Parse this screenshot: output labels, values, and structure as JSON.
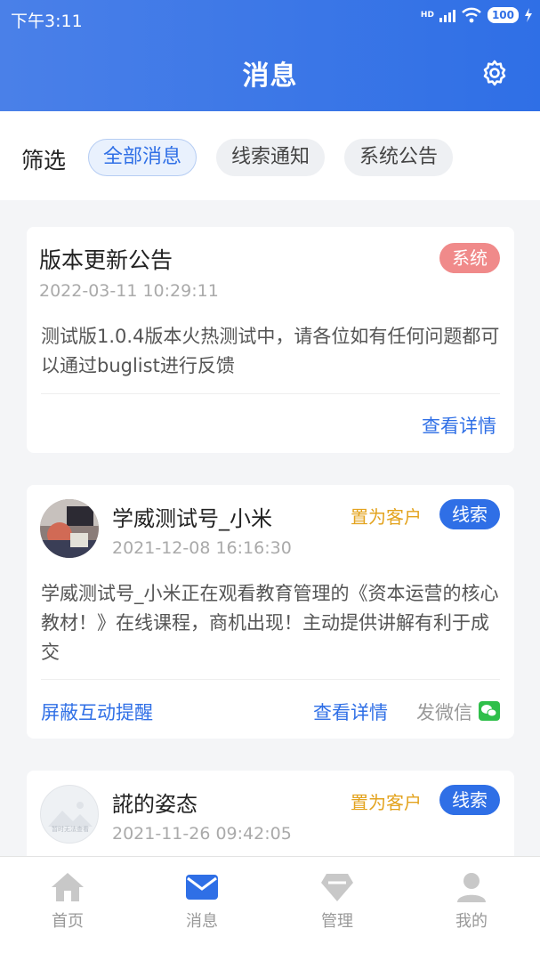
{
  "status_bar": {
    "time": "下午3:11",
    "network": "HD",
    "battery": "100"
  },
  "header": {
    "title": "消息"
  },
  "filter": {
    "label": "筛选",
    "chips": [
      {
        "label": "全部消息",
        "active": true
      },
      {
        "label": "线索通知",
        "active": false
      },
      {
        "label": "系统公告",
        "active": false
      }
    ]
  },
  "messages": [
    {
      "title": "版本更新公告",
      "tag": "系统",
      "time": "2022-03-11 10:29:11",
      "body": "测试版1.0.4版本火热测试中，请各位如有任何问题都可以通过buglist进行反馈",
      "detail_link": "查看详情"
    },
    {
      "name": "学威测试号_小米",
      "set_customer": "置为客户",
      "tag": "线索",
      "time": "2021-12-08 16:16:30",
      "body": "学威测试号_小米正在观看教育管理的《资本运营的核心教材！》在线课程，商机出现！主动提供讲解有利于成交",
      "block_link": "屏蔽互动提醒",
      "detail_link": "查看详情",
      "wechat_label": "发微信"
    },
    {
      "name": "誮的姿态",
      "set_customer": "置为客户",
      "tag": "线索",
      "time": "2021-11-26 09:42:05",
      "avatar_placeholder": "暂时无法查看"
    }
  ],
  "tabbar": [
    {
      "label": "首页",
      "icon": "home-icon",
      "active": false
    },
    {
      "label": "消息",
      "icon": "message-icon",
      "active": true
    },
    {
      "label": "管理",
      "icon": "diamond-icon",
      "active": false
    },
    {
      "label": "我的",
      "icon": "user-icon",
      "active": false
    }
  ],
  "colors": {
    "primary": "#2f6fe6",
    "system_tag": "#f08a8a",
    "customer": "#e3a31e",
    "wechat": "#2fbf4a"
  }
}
